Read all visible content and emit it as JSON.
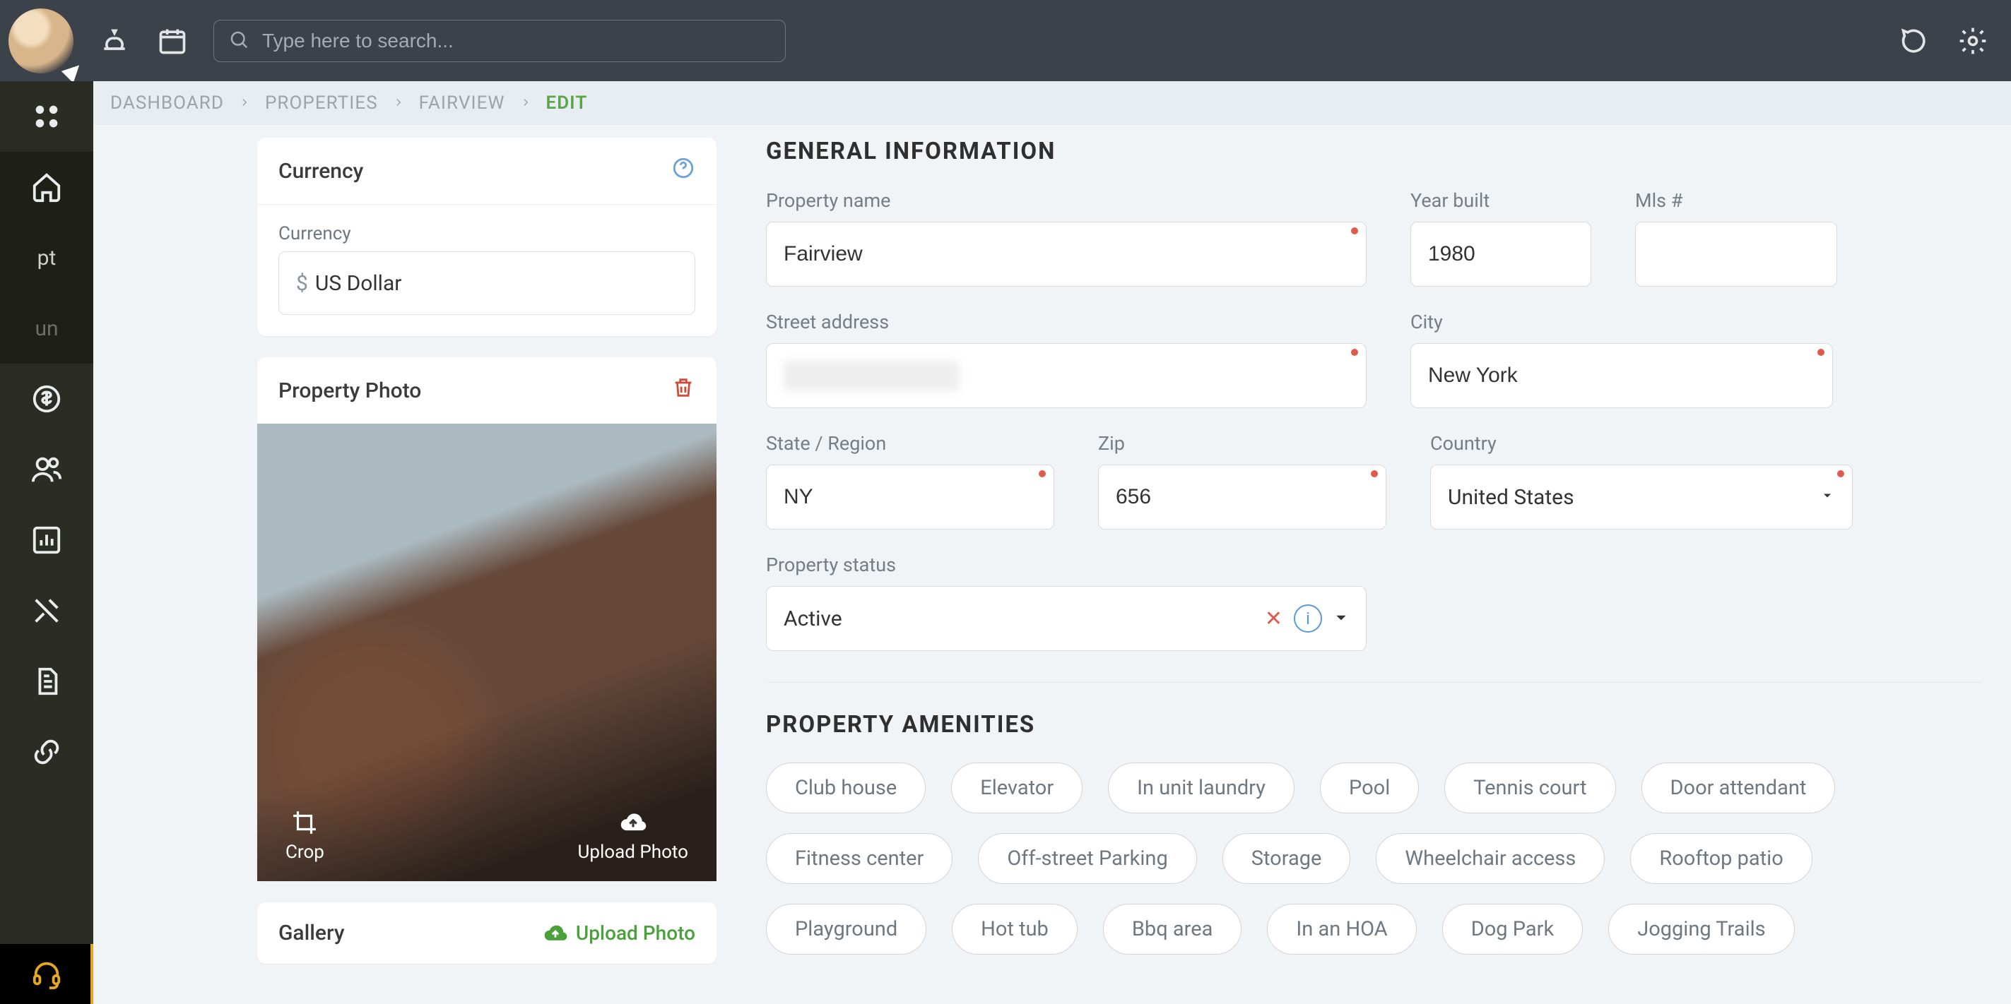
{
  "search": {
    "placeholder": "Type here to search..."
  },
  "sidebar_tags": {
    "pt": "pt",
    "un": "un"
  },
  "breadcrumbs": {
    "dashboard": "DASHBOARD",
    "properties": "PROPERTIES",
    "fairview": "FAIRVIEW",
    "edit": "EDIT"
  },
  "currency_panel": {
    "title": "Currency",
    "label": "Currency",
    "prefix": "$",
    "value": "US Dollar"
  },
  "photo_panel": {
    "title": "Property Photo",
    "crop": "Crop",
    "upload": "Upload Photo"
  },
  "gallery_panel": {
    "title": "Gallery",
    "upload": "Upload Photo"
  },
  "general": {
    "section_title": "GENERAL INFORMATION",
    "property_name": {
      "label": "Property name",
      "value": "Fairview"
    },
    "year_built": {
      "label": "Year built",
      "value": "1980"
    },
    "mls": {
      "label": "Mls #",
      "value": ""
    },
    "street": {
      "label": "Street address",
      "value": ""
    },
    "city": {
      "label": "City",
      "value": "New York"
    },
    "state": {
      "label": "State / Region",
      "value": "NY"
    },
    "zip": {
      "label": "Zip",
      "value": "656"
    },
    "country": {
      "label": "Country",
      "value": "United States"
    },
    "status": {
      "label": "Property status",
      "value": "Active"
    }
  },
  "amenities": {
    "section_title": "PROPERTY AMENITIES",
    "items": [
      "Club house",
      "Elevator",
      "In unit laundry",
      "Pool",
      "Tennis court",
      "Door attendant",
      "Fitness center",
      "Off-street Parking",
      "Storage",
      "Wheelchair access",
      "Rooftop patio",
      "Playground",
      "Hot tub",
      "Bbq area",
      "In an HOA",
      "Dog Park",
      "Jogging Trails"
    ]
  }
}
